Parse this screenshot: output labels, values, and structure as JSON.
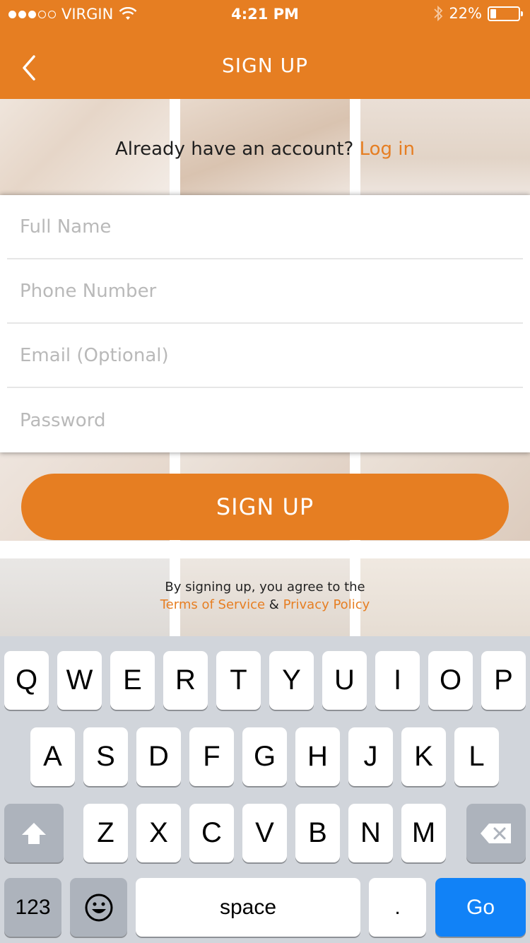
{
  "status_bar": {
    "carrier": "VIRGIN",
    "time": "4:21 PM",
    "battery": "22%",
    "battery_level": 0.22
  },
  "header": {
    "title": "SIGN UP"
  },
  "login_prompt": {
    "text": "Already have an account?",
    "link": "Log in"
  },
  "form": {
    "full_name_placeholder": "Full Name",
    "phone_placeholder": "Phone Number",
    "email_placeholder": "Email (Optional)",
    "password_placeholder": "Password"
  },
  "signup_button": "SIGN UP",
  "terms": {
    "line1": "By signing up, you agree to the",
    "tos": "Terms of Service",
    "amp": "&",
    "privacy": "Privacy Policy"
  },
  "keyboard": {
    "row1": [
      "Q",
      "W",
      "E",
      "R",
      "T",
      "Y",
      "U",
      "I",
      "O",
      "P"
    ],
    "row2": [
      "A",
      "S",
      "D",
      "F",
      "G",
      "H",
      "J",
      "K",
      "L"
    ],
    "row3": [
      "Z",
      "X",
      "C",
      "V",
      "B",
      "N",
      "M"
    ],
    "numbers": "123",
    "space": "space",
    "period": ".",
    "go": "Go"
  },
  "colors": {
    "accent": "#E67E22",
    "go_key": "#1182F7"
  }
}
